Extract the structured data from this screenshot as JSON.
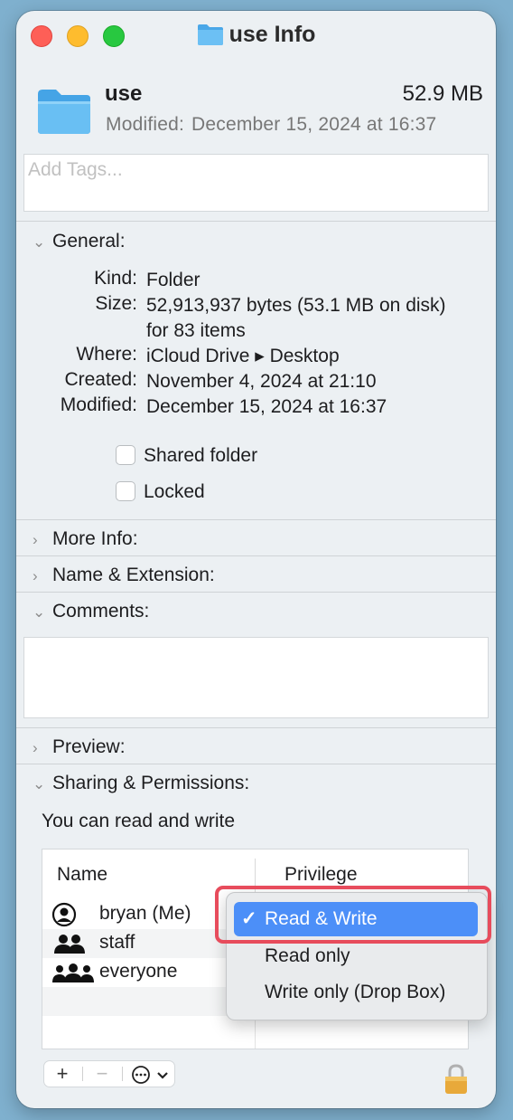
{
  "window": {
    "title": "use Info"
  },
  "header": {
    "name": "use",
    "size": "52.9 MB",
    "modified_label": "Modified:",
    "modified_value": "December 15, 2024 at 16:37"
  },
  "tags": {
    "placeholder": "Add Tags..."
  },
  "general": {
    "title": "General:",
    "rows": [
      {
        "key": "Kind:",
        "value": "Folder"
      },
      {
        "key": "Size:",
        "value": "52,913,937 bytes (53.1 MB on disk) for 83 items"
      },
      {
        "key": "Where:",
        "value": "iCloud Drive ▸ Desktop"
      },
      {
        "key": "Created:",
        "value": "November 4, 2024 at 21:10"
      },
      {
        "key": "Modified:",
        "value": "December 15, 2024 at 16:37"
      }
    ],
    "shared_folder_label": "Shared folder",
    "locked_label": "Locked"
  },
  "sections": {
    "more_info": "More Info:",
    "name_extension": "Name & Extension:",
    "comments": "Comments:",
    "preview": "Preview:",
    "sharing": "Sharing & Permissions:"
  },
  "permissions": {
    "note": "You can read and write",
    "col_name": "Name",
    "col_privilege": "Privilege",
    "rows": [
      {
        "name": "bryan (Me)",
        "icon": "user-icon"
      },
      {
        "name": "staff",
        "icon": "group-icon"
      },
      {
        "name": "everyone",
        "icon": "everyone-icon"
      }
    ]
  },
  "toolbar": {
    "add_label": "+",
    "remove_label": "−"
  },
  "popup": {
    "options": [
      "Read & Write",
      "Read only",
      "Write only (Drop Box)"
    ],
    "selected": "Read & Write",
    "check": "✓"
  },
  "colors": {
    "accent": "#4c8ff8",
    "highlight": "#e74c5c",
    "folder": "#5ab4ef"
  }
}
